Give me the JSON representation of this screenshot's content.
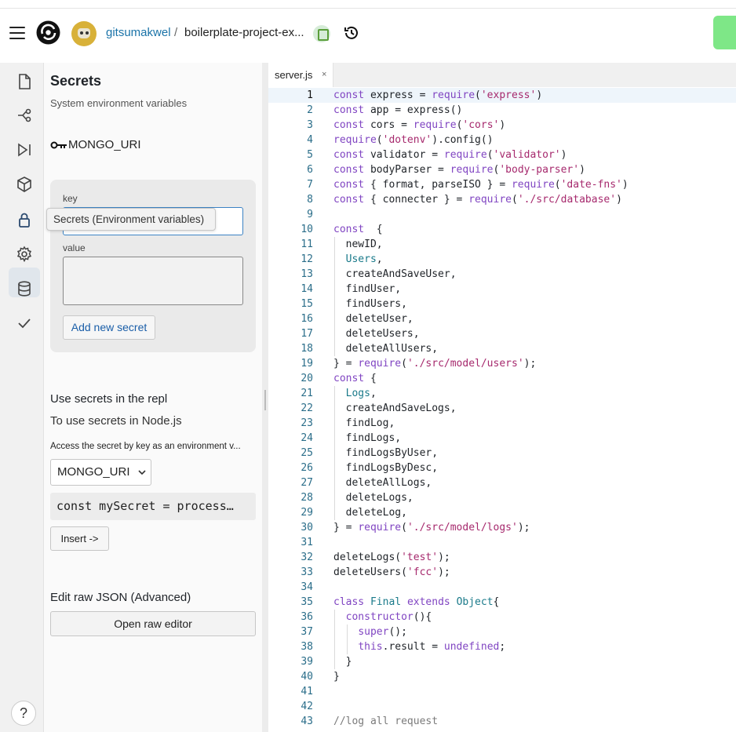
{
  "header": {
    "user": "gitsumakwel",
    "separator": "/",
    "repo": "boilerplate-project-ex..."
  },
  "sidebar": {
    "items": [
      {
        "name": "files-icon"
      },
      {
        "name": "git-icon"
      },
      {
        "name": "debugger-icon"
      },
      {
        "name": "packages-icon"
      },
      {
        "name": "lock-icon"
      },
      {
        "name": "settings-icon"
      },
      {
        "name": "database-icon"
      },
      {
        "name": "check-icon"
      }
    ],
    "help_label": "?",
    "tooltip": "Secrets (Environment variables)"
  },
  "secrets_panel": {
    "title": "Secrets",
    "subtitle": "System environment variables",
    "existing_secret": "MONGO_URI",
    "form": {
      "key_label": "key",
      "key_value": "",
      "value_label": "value",
      "value_value": "",
      "add_button": "Add new secret"
    },
    "use_section": {
      "heading": "Use secrets in the repl",
      "subheading": "To use secrets in Node.js",
      "hint": "Access the secret by key as an environment v...",
      "select_value": "MONGO_URI",
      "snippet": "const mySecret = process…",
      "insert_button": "Insert ->"
    },
    "raw_section": {
      "heading": "Edit raw JSON (Advanced)",
      "button": "Open raw editor"
    }
  },
  "editor": {
    "tab_label": "server.js",
    "tab_close": "×",
    "current_line": 1,
    "lines": [
      "const express = require('express')",
      "const app = express()",
      "const cors = require('cors')",
      "require('dotenv').config()",
      "const validator = require('validator')",
      "const bodyParser = require('body-parser')",
      "const { format, parseISO } = require('date-fns')",
      "const { connecter } = require('./src/database')",
      "",
      "const  {",
      "  newID,",
      "  Users,",
      "  createAndSaveUser,",
      "  findUser,",
      "  findUsers,",
      "  deleteUser,",
      "  deleteUsers,",
      "  deleteAllUsers,",
      "} = require('./src/model/users');",
      "const {",
      "  Logs,",
      "  createAndSaveLogs,",
      "  findLog,",
      "  findLogs,",
      "  findLogsByUser,",
      "  findLogsByDesc,",
      "  deleteAllLogs,",
      "  deleteLogs,",
      "  deleteLog,",
      "} = require('./src/model/logs');",
      "",
      "deleteLogs('test');",
      "deleteUsers('fcc');",
      "",
      "class Final extends Object{",
      "  constructor(){",
      "    super();",
      "    this.result = undefined;",
      "  }",
      "}",
      "",
      "",
      "//log all request"
    ]
  },
  "colors": {
    "accent": "#3b82c4",
    "run_button": "#7ee787",
    "keyword": "#8045c2",
    "string": "#a6296d",
    "line_number": "#2a6d89"
  }
}
